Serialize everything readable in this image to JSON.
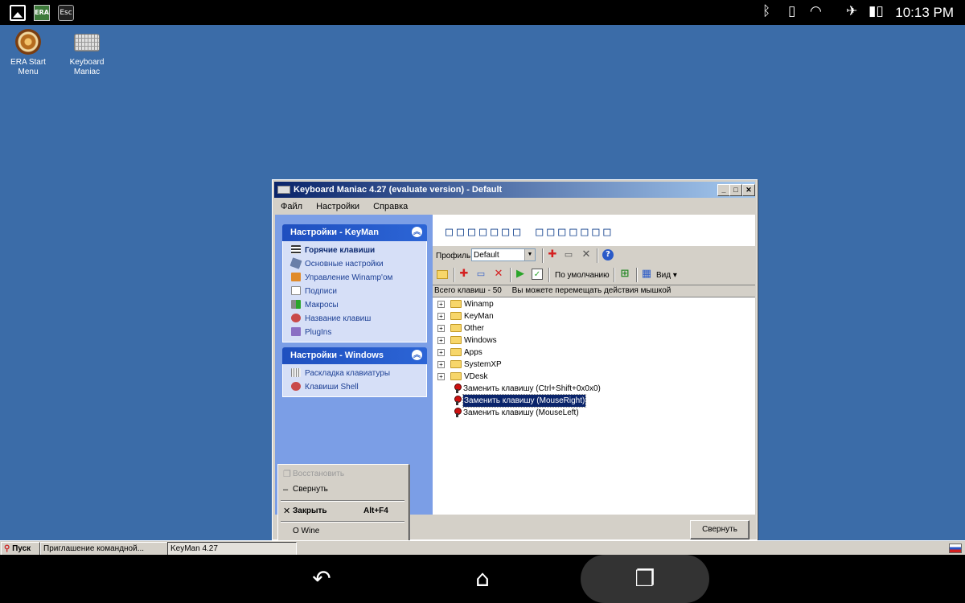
{
  "statusbar": {
    "left_icons": [
      "gallery-icon",
      "era-icon",
      "esc-icon"
    ],
    "era_label": "ERA",
    "esc_label": "Esc",
    "right_icons": [
      "bluetooth-icon",
      "vibrate-icon",
      "wifi-icon",
      "airplane-icon",
      "battery-icon"
    ],
    "time": "10:13 PM"
  },
  "desktop": {
    "icons": [
      {
        "label": "ERA Start Menu",
        "icon": "era-start-icon"
      },
      {
        "label": "Keyboard Maniac",
        "icon": "keyboard-icon"
      }
    ]
  },
  "window": {
    "title": "Keyboard Maniac 4.27 (evaluate version) - Default",
    "controls": {
      "min": "_",
      "max": "□",
      "close": "✕"
    },
    "menu": [
      "Файл",
      "Настройки",
      "Справка"
    ],
    "panels": [
      {
        "title": "Настройки - KeyMan",
        "items": [
          "Горячие клавиши",
          "Основные настройки",
          "Управление Winamp'ом",
          "Подписи",
          "Макросы",
          "Название клавиш",
          "PlugIns"
        ]
      },
      {
        "title": "Настройки - Windows",
        "items": [
          "Раскладка клавиатуры",
          "Клавиши Shell"
        ]
      }
    ],
    "content_title": "□□□□□□□ □□□□□□□",
    "toolbar1": {
      "profile_label": "Профиль",
      "profile_value": "Default"
    },
    "toolbar2": {
      "default_label": "По умолчанию",
      "view_label": "Вид"
    },
    "status": {
      "total": "Всего клавиш - 50",
      "hint": "Вы можете перемещать действия мышкой"
    },
    "tree": {
      "folders": [
        "Winamp",
        "KeyMan",
        "Other",
        "Windows",
        "Apps",
        "SystemXP",
        "VDesk"
      ],
      "keys": [
        "Заменить клавишу (Ctrl+Shift+0x0x0)",
        "Заменить клавишу (MouseRight)",
        "Заменить клавишу (MouseLeft)"
      ]
    },
    "collapse_button": "Свернуть"
  },
  "context_menu": {
    "restore": "Восстановить",
    "minimize": "Свернуть",
    "close": "Закрыть",
    "close_shortcut": "Alt+F4",
    "about": "O Wine"
  },
  "taskbar": {
    "start": "Пуск",
    "tasks": [
      "Приглашение командной...",
      "KeyMan 4.27"
    ]
  },
  "navbar": {
    "back": "↶",
    "home": "⌂",
    "recent": "❐"
  },
  "colors": {
    "desktop": "#3b6ca8",
    "title_start": "#0a246a",
    "sidebar": "#7b9ee6",
    "panel_head": "#1f4fbf"
  }
}
